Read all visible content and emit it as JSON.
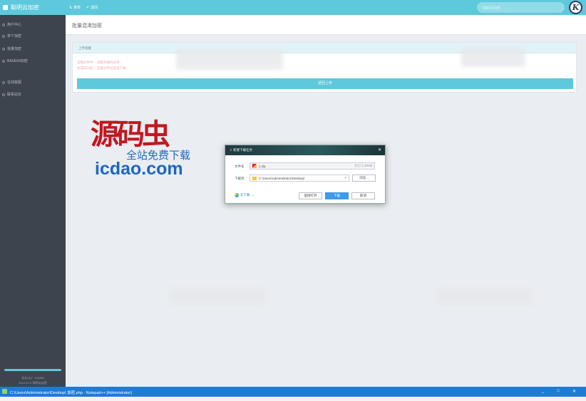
{
  "app": {
    "title": "聪明云加密",
    "top_links": [
      "菜单",
      "返回"
    ],
    "search_placeholder": "搜索未加密",
    "logo_letter": "K"
  },
  "sidebar": {
    "items": [
      "用户中心",
      "单个加密",
      "批量加密",
      "BASE64加密",
      "在线客服",
      "联系站长"
    ],
    "footer_qq": "站长QQ：123456",
    "footer_copy": "2019-23 © 聪明云加密"
  },
  "page": {
    "title": "批量混淆加密",
    "card_header": "上传提醒",
    "error_lines": [
      "压缩文件中：  加密失败的文件",
      "生成成功后：  压缩文件已生成下载"
    ],
    "back_button": "返回上传"
  },
  "watermark": {
    "brand": "源码虫",
    "tagline": "全站免费下载",
    "url": "icdao.com"
  },
  "dialog": {
    "title": "新建下载任务",
    "close": "✕",
    "filename_label": "文件名",
    "filename": "1.zip",
    "size": "大小:1.00KB",
    "path_label": "下载到",
    "path": "C:\\Users\\Administrator\\Desktop\\",
    "browse": "浏览...",
    "cloud": "云下载",
    "open_btn": "直接打开",
    "download_btn": "下载",
    "cancel_btn": "取消"
  },
  "taskbar": {
    "title": "C:\\Users\\Administrator\\Desktop\\              加密.php - Notepad++ [Administrator]",
    "controls": [
      "_",
      "□",
      "✕"
    ]
  },
  "colors": {
    "accent": "#5ec8dc",
    "sidebar": "#3e444e",
    "taskbar": "#1e7bd6"
  }
}
